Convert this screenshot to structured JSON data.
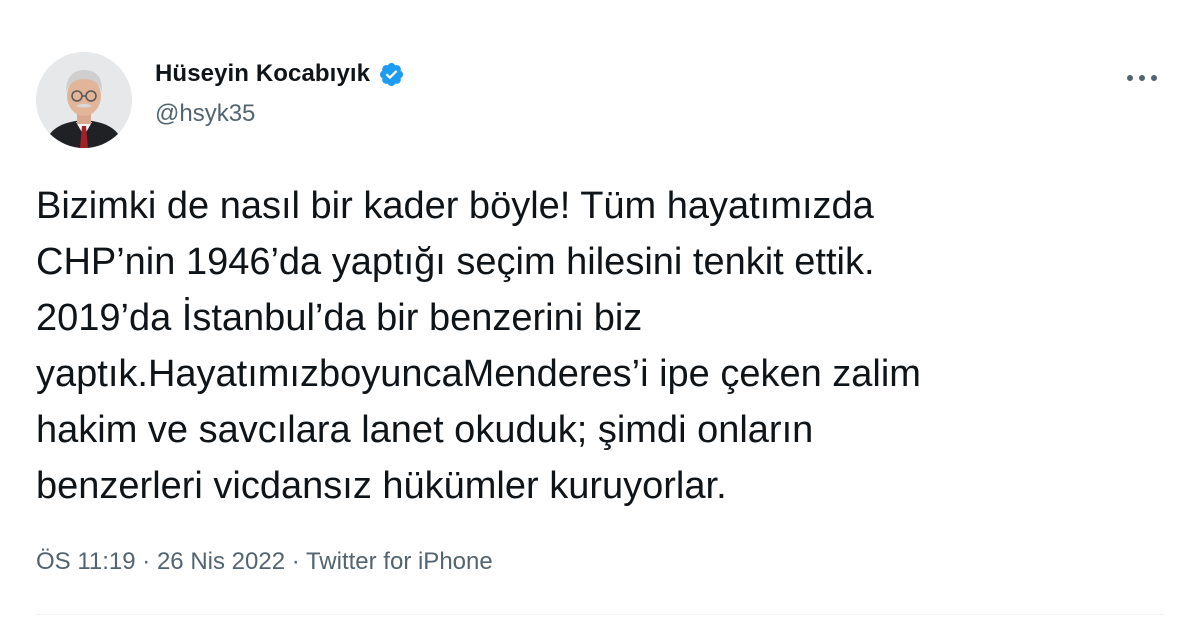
{
  "author": {
    "display_name": "Hüseyin Kocabıyık",
    "handle": "@hsyk35",
    "verified": true,
    "verified_color": "#1d9bf0"
  },
  "tweet": {
    "lines": [
      "Bizimki de nasıl bir kader böyle! Tüm hayatımızda",
      "CHP’nin 1946’da yaptığı seçim hilesini tenkit ettik.",
      "2019’da İstanbul’da bir benzerini biz",
      "yaptık.HayatımızboyuncaMenderes’i ipe çeken zalim",
      "hakim ve savcılara lanet okuduk; şimdi onların",
      "benzerleri vicdansız hükümler kuruyorlar."
    ]
  },
  "meta": {
    "time": "ÖS 11:19",
    "separator": " · ",
    "date": "26 Nis 2022",
    "source": "Twitter for iPhone"
  },
  "icons": {
    "more": "more-horizontal-icon",
    "verified": "verified-badge-icon"
  }
}
